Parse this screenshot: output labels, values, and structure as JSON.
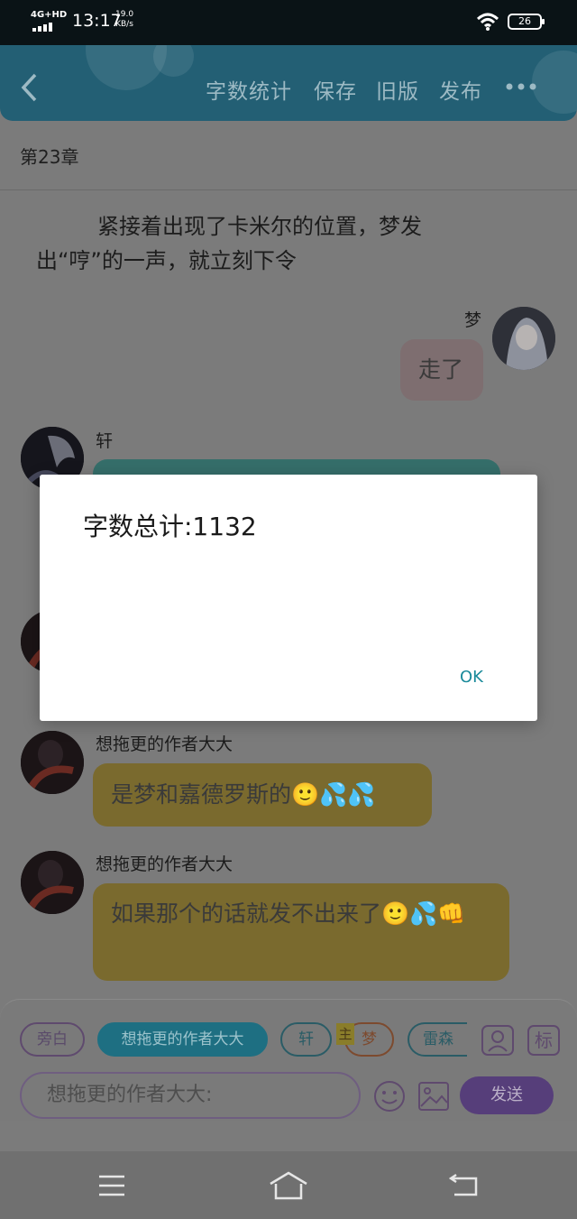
{
  "status_bar": {
    "network": "4G+HD",
    "time": "13:17",
    "speed_value": "19.0",
    "speed_unit": "KB/s",
    "battery": "26"
  },
  "header": {
    "back_icon": "chevron-left-icon",
    "actions": [
      "字数统计",
      "保存",
      "旧版",
      "发布"
    ],
    "more_icon": "more-icon"
  },
  "chapter": "第23章",
  "narration": "紧接着出现了卡米尔的位置，梦发出“哼”的一声，就立刻下令",
  "messages": [
    {
      "side": "right",
      "name": "梦",
      "text": "走了",
      "bubble_color": "#7e6e70"
    },
    {
      "side": "left",
      "name": "轩",
      "text": "",
      "bubble_color": "#356e6a"
    },
    {
      "side": "left",
      "name": "想拖更的作者大大",
      "text": "是梦和嘉德罗斯的🙂💦💦",
      "bubble_color": "#7a6a2e"
    },
    {
      "side": "left",
      "name": "想拖更的作者大大",
      "text": "如果那个的话就发不出来了🙂💦👊",
      "bubble_color": "#7a6a2e"
    }
  ],
  "dialog": {
    "message": "字数总计:1132",
    "ok_label": "OK"
  },
  "composer": {
    "roles": [
      "旁白",
      "想拖更的作者大大",
      "轩",
      "梦",
      "雷森"
    ],
    "main_tag": "主",
    "input_placeholder": "想拖更的作者大大:",
    "send_label": "发送",
    "person_icon": "person-icon",
    "tag_icon_label": "标",
    "emoji_icon": "smiley-icon",
    "image_icon": "image-icon"
  },
  "nav_bar": {
    "icons": [
      "menu-icon",
      "home-icon",
      "back-icon"
    ]
  }
}
